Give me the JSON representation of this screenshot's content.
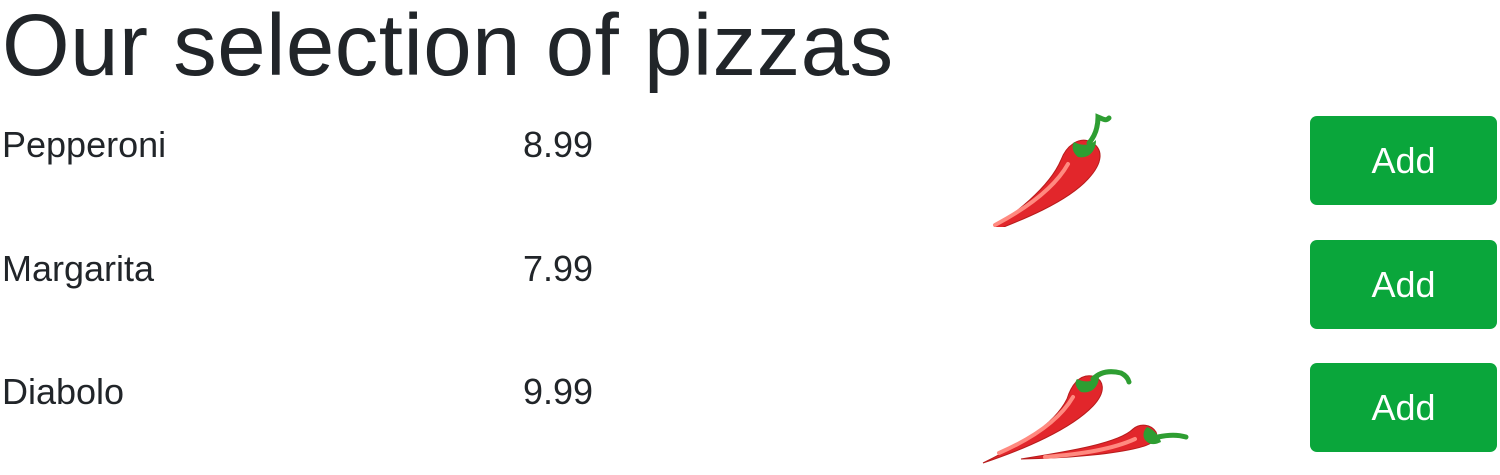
{
  "title": "Our selection of pizzas",
  "colors": {
    "text": "#212529",
    "add_button_bg": "#0aa63b",
    "add_button_text": "#ffffff",
    "chili_red": "#e2262b",
    "chili_stem": "#2e9e32"
  },
  "pizzas": [
    {
      "name": "Pepperoni",
      "price": "8.99",
      "spice_icon": "single-chili-pepper-icon",
      "add_label": "Add"
    },
    {
      "name": "Margarita",
      "price": "7.99",
      "spice_icon": "",
      "add_label": "Add"
    },
    {
      "name": "Diabolo",
      "price": "9.99",
      "spice_icon": "double-chili-pepper-icon",
      "add_label": "Add"
    }
  ]
}
